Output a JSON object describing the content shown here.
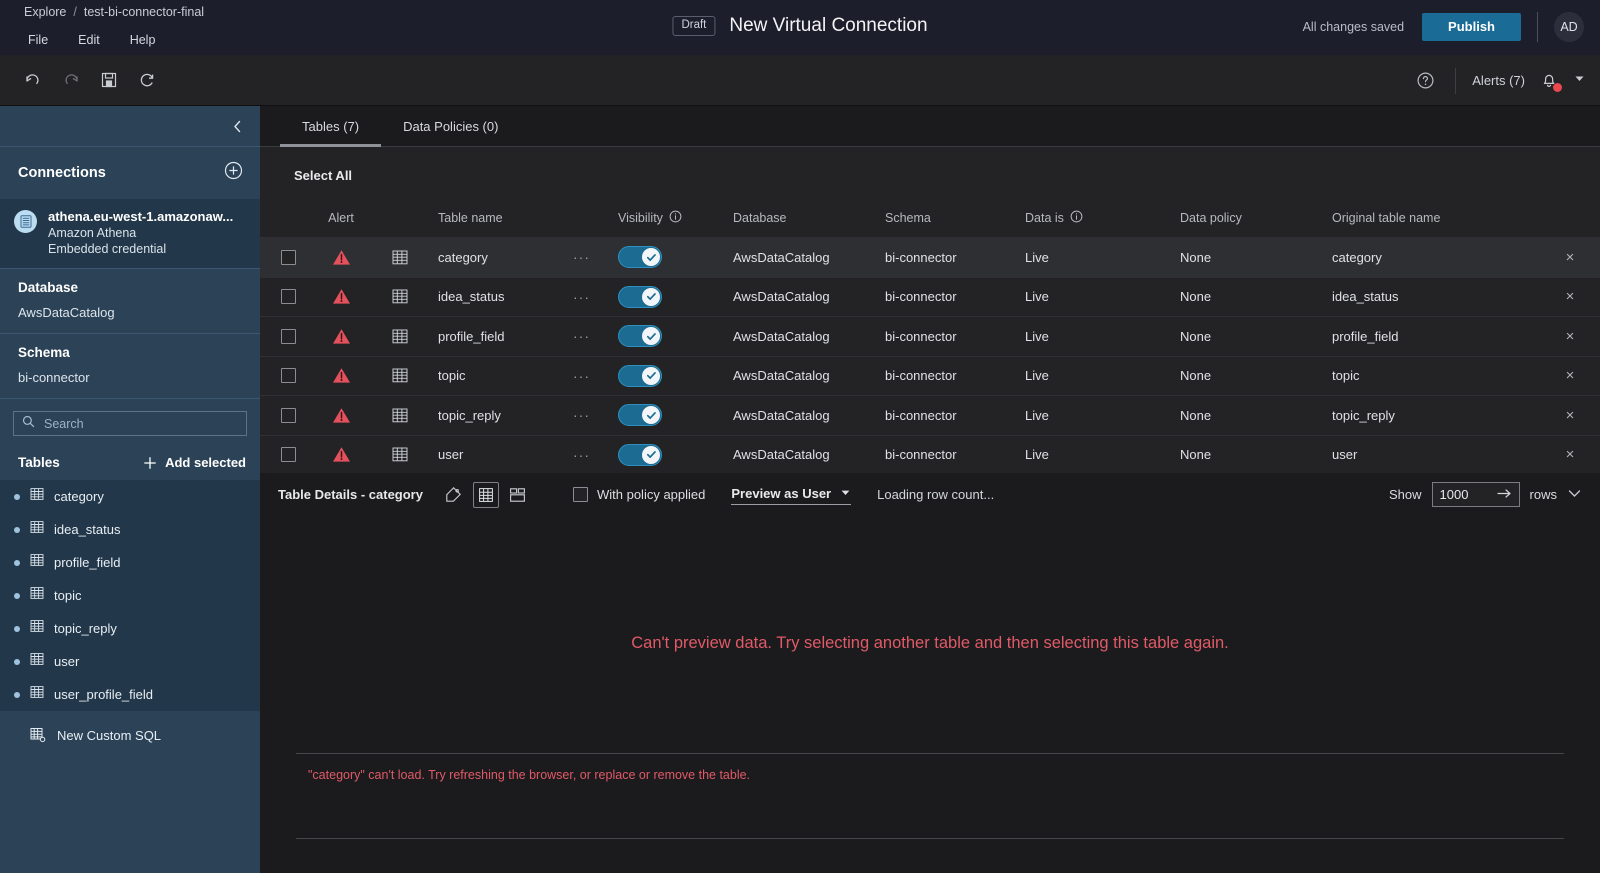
{
  "topbar": {
    "breadcrumb": {
      "root": "Explore",
      "separator": "/",
      "current": "test-bi-connector-final"
    },
    "menu": [
      "File",
      "Edit",
      "Help"
    ],
    "draft_badge": "Draft",
    "title": "New Virtual Connection",
    "save_status": "All changes saved",
    "publish_label": "Publish",
    "avatar_initials": "AD",
    "accent_color": "#1a6c96"
  },
  "toolbar": {
    "undo": "undo-icon",
    "redo": "redo-icon",
    "save": "save-icon",
    "refresh": "refresh-icon",
    "help": "help-icon",
    "alerts_label": "Alerts (7)",
    "alerts_count": 7,
    "bell_dot_color": "#e8484e"
  },
  "sidebar": {
    "collapse_label": "<",
    "connections_header": "Connections",
    "add_connection": "add-icon",
    "connection": {
      "name": "athena.eu-west-1.amazonaw...",
      "type": "Amazon Athena",
      "credential": "Embedded credential"
    },
    "database": {
      "header": "Database",
      "value": "AwsDataCatalog"
    },
    "schema": {
      "header": "Schema",
      "value": "bi-connector"
    },
    "search": {
      "placeholder": "Search",
      "value": ""
    },
    "tables_header": "Tables",
    "add_selected_label": "Add selected",
    "tables": [
      "category",
      "idea_status",
      "profile_field",
      "topic",
      "topic_reply",
      "user",
      "user_profile_field"
    ],
    "new_custom_sql": "New Custom SQL"
  },
  "main": {
    "tabs": [
      {
        "label": "Tables (7)",
        "active": true
      },
      {
        "label": "Data Policies (0)",
        "active": false
      }
    ],
    "select_all_label": "Select All",
    "columns": [
      "Alert",
      "Table name",
      "Visibility",
      "Database",
      "Schema",
      "Data is",
      "Data policy",
      "Original table name"
    ],
    "rows": [
      {
        "name": "category",
        "visible": true,
        "database": "AwsDataCatalog",
        "schema": "bi-connector",
        "data_is": "Live",
        "data_policy": "None",
        "original": "category",
        "selected": true,
        "alert": true
      },
      {
        "name": "idea_status",
        "visible": true,
        "database": "AwsDataCatalog",
        "schema": "bi-connector",
        "data_is": "Live",
        "data_policy": "None",
        "original": "idea_status",
        "selected": false,
        "alert": true
      },
      {
        "name": "profile_field",
        "visible": true,
        "database": "AwsDataCatalog",
        "schema": "bi-connector",
        "data_is": "Live",
        "data_policy": "None",
        "original": "profile_field",
        "selected": false,
        "alert": true
      },
      {
        "name": "topic",
        "visible": true,
        "database": "AwsDataCatalog",
        "schema": "bi-connector",
        "data_is": "Live",
        "data_policy": "None",
        "original": "topic",
        "selected": false,
        "alert": true
      },
      {
        "name": "topic_reply",
        "visible": true,
        "database": "AwsDataCatalog",
        "schema": "bi-connector",
        "data_is": "Live",
        "data_policy": "None",
        "original": "topic_reply",
        "selected": false,
        "alert": true
      },
      {
        "name": "user",
        "visible": true,
        "database": "AwsDataCatalog",
        "schema": "bi-connector",
        "data_is": "Live",
        "data_policy": "None",
        "original": "user",
        "selected": false,
        "alert": true
      }
    ],
    "row_dots": "···",
    "close_glyph": "×"
  },
  "details": {
    "title": "Table Details - category",
    "tag_icon": "tag-icon",
    "grid_icon": "grid-view-icon",
    "card_icon": "card-view-icon",
    "policy_checkbox_label": "With policy applied",
    "policy_checked": false,
    "preview_as_label": "Preview as User",
    "row_count_status": "Loading row count...",
    "show_label": "Show",
    "rows_value": "1000",
    "rows_label": "rows"
  },
  "preview": {
    "message": "Can't preview data. Try selecting another table and then selecting this table again.",
    "error": "\"category\" can't load. Try refreshing the browser, or replace or remove the table.",
    "error_color": "#e05a68"
  }
}
